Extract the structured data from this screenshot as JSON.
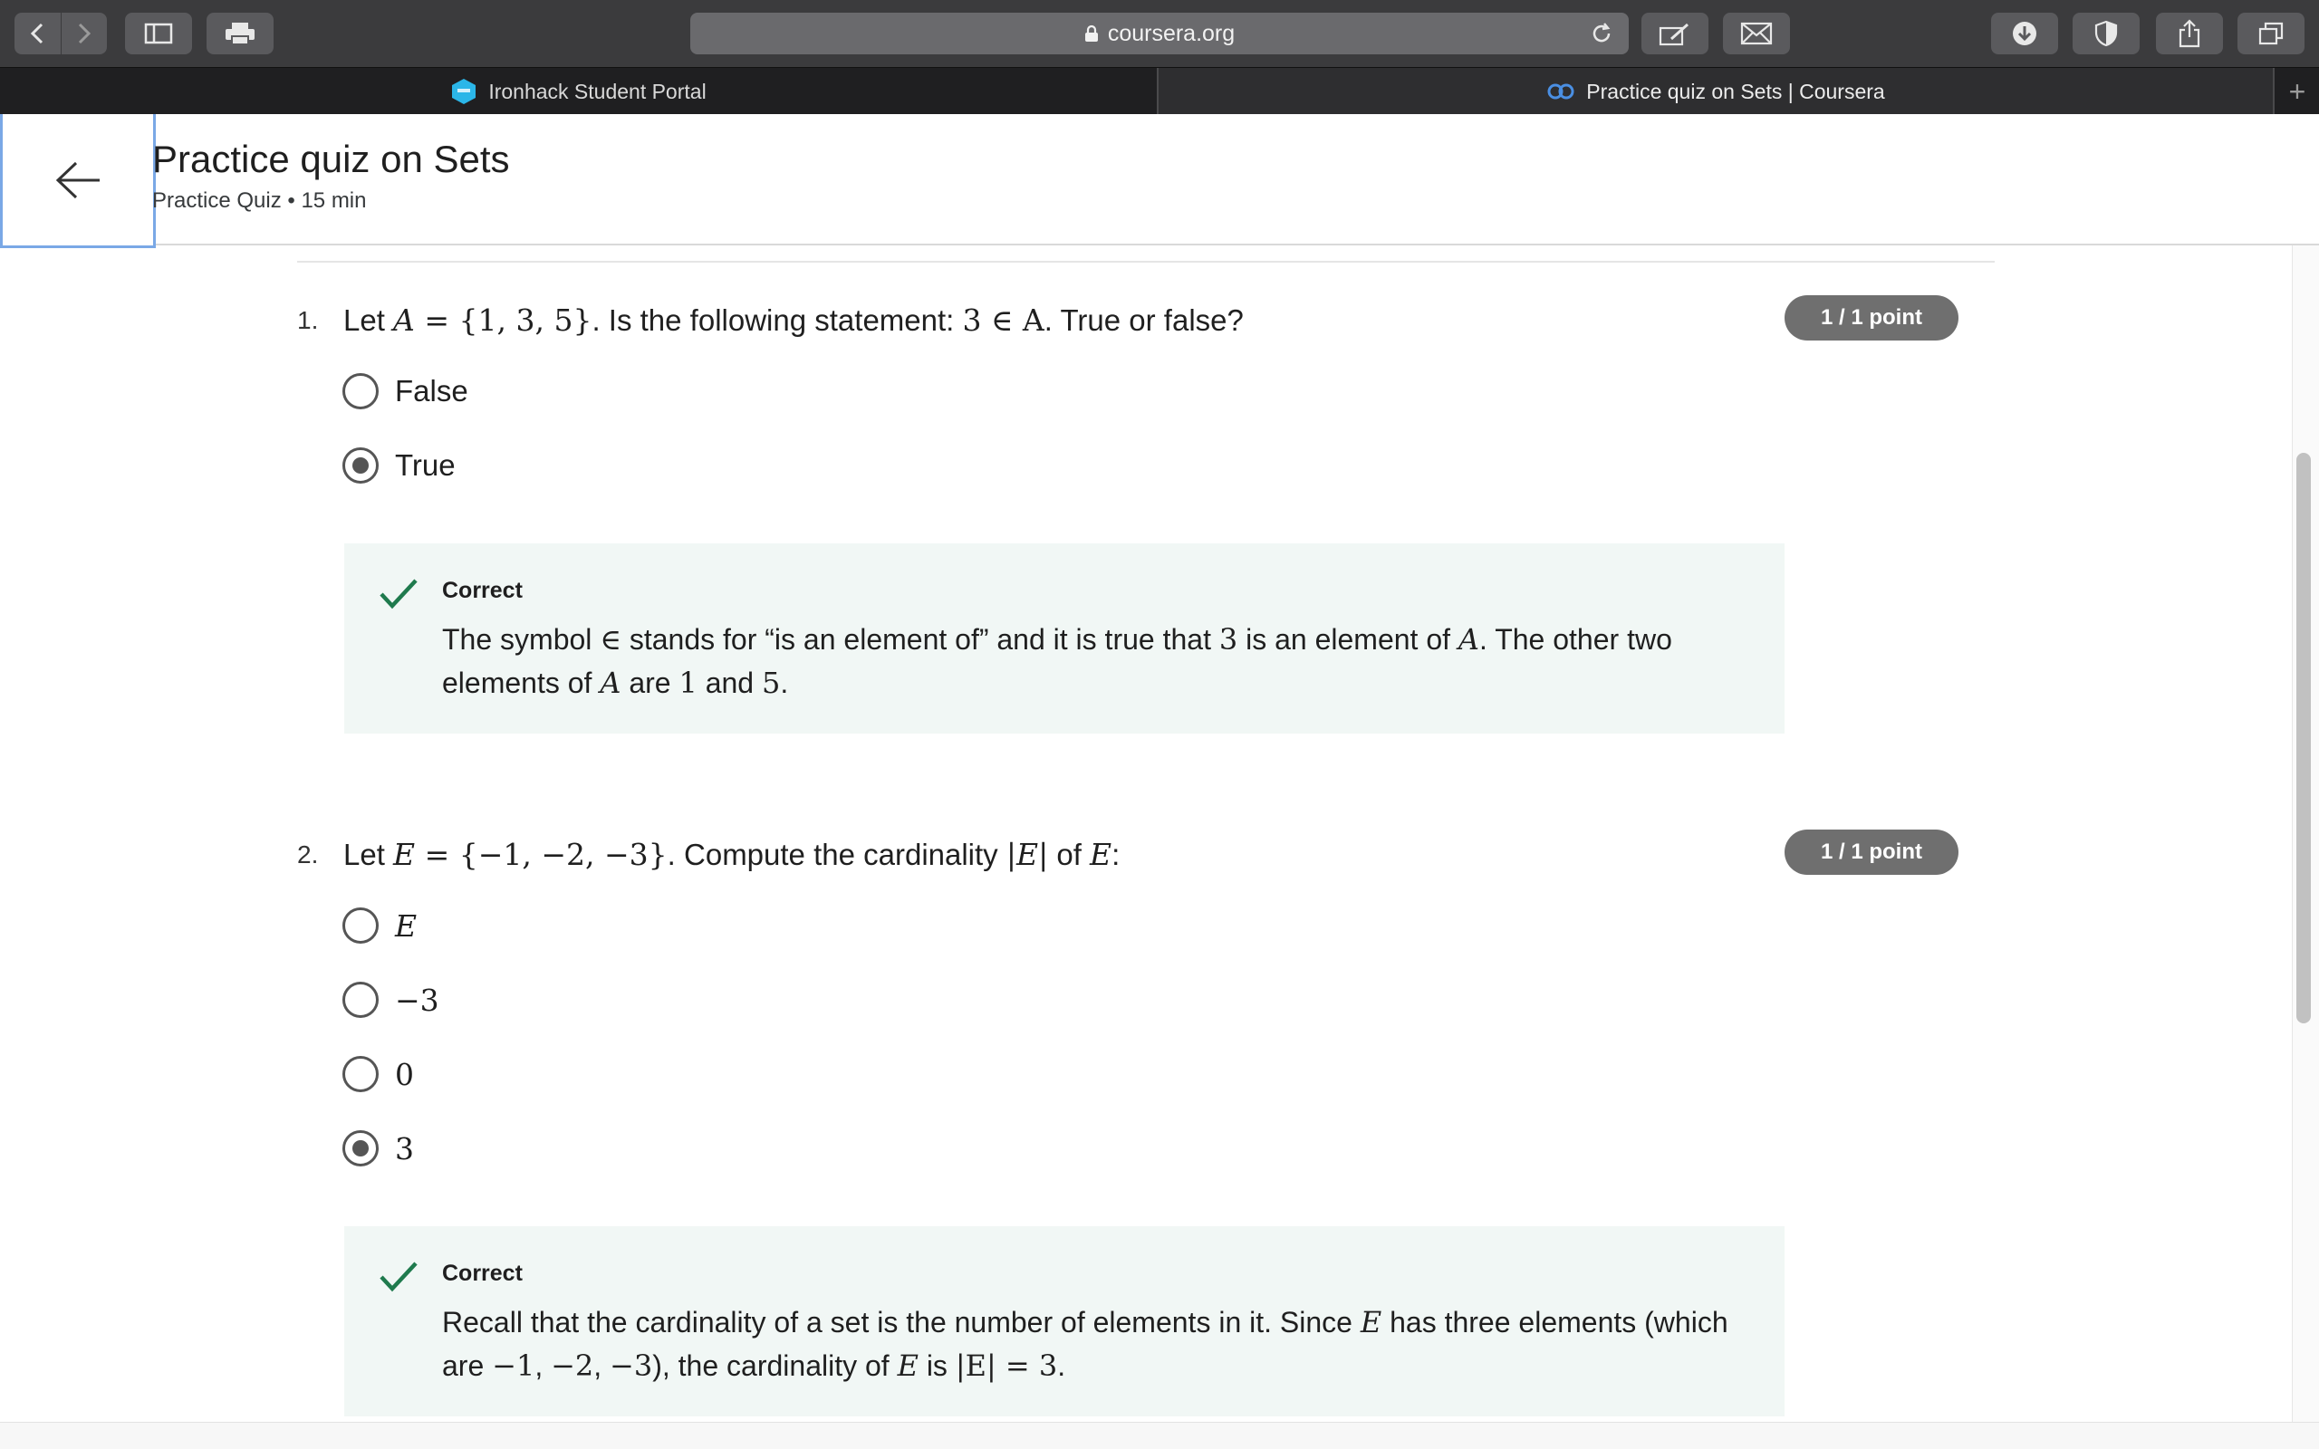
{
  "browser": {
    "url": "coursera.org",
    "tabs": [
      {
        "label": "Ironhack Student Portal",
        "active": false
      },
      {
        "label": "Practice quiz on Sets | Coursera",
        "active": true
      }
    ],
    "new_tab_label": "+"
  },
  "header": {
    "title": "Practice quiz on Sets",
    "subtitle": "Practice Quiz • 15 min"
  },
  "questions": [
    {
      "number": "1.",
      "text_parts": [
        "Let ",
        "A",
        " = ",
        "{1, 3, 5}",
        ". Is the following statement: ",
        "3 ∈ A",
        ". True or false?"
      ],
      "score": "1 / 1 point",
      "options": [
        {
          "label": "False",
          "selected": false
        },
        {
          "label": "True",
          "selected": true
        }
      ],
      "feedback": {
        "title": "Correct",
        "text_parts": [
          "The symbol ",
          "∈",
          " stands for “is an element of” and it is true that ",
          "3",
          " is an element of ",
          "A",
          ". The other two elements of ",
          "A",
          " are ",
          "1",
          " and ",
          "5",
          "."
        ]
      }
    },
    {
      "number": "2.",
      "text_parts": [
        "Let ",
        "E",
        " = ",
        "{−1, −2, −3}",
        ". Compute the cardinality ",
        "|E|",
        " of ",
        "E",
        ":"
      ],
      "score": "1 / 1 point",
      "options": [
        {
          "label": "E",
          "selected": false
        },
        {
          "label": "−3",
          "selected": false
        },
        {
          "label": "0",
          "selected": false
        },
        {
          "label": "3",
          "selected": true
        }
      ],
      "feedback": {
        "title": "Correct",
        "text_parts": [
          "Recall that the cardinality of a set is the number of elements in it. Since ",
          "E",
          " has three elements (which are ",
          "−1",
          ", ",
          "−2",
          ", ",
          "−3",
          "), the cardinality of ",
          "E",
          " is ",
          "|E| = 3",
          "."
        ]
      }
    }
  ],
  "colors": {
    "feedback_bg": "#f1f7f5",
    "check_green": "#1f7a4d",
    "badge_bg": "#6f6f6f",
    "focus_outline": "#7aa8e6"
  },
  "icons": [
    "back-arrow-icon",
    "forward-arrow-icon",
    "sidebar-icon",
    "print-icon",
    "lock-icon",
    "reload-icon",
    "annotate-icon",
    "mail-icon",
    "download-icon",
    "privacy-shield-icon",
    "share-icon",
    "tabs-overview-icon",
    "ironhack-favicon",
    "coursera-favicon",
    "check-icon"
  ]
}
